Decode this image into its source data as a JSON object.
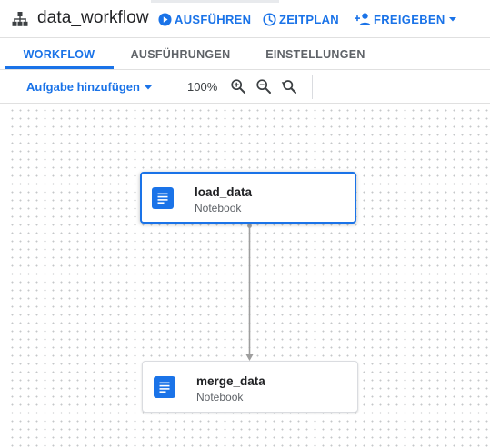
{
  "header": {
    "title": "data_workflow",
    "title_icon": "workflow-tree-icon",
    "actions": [
      {
        "label": "AUSFÜHREN",
        "icon": "play-circle-icon"
      },
      {
        "label": "ZEITPLAN",
        "icon": "clock-icon"
      },
      {
        "label": "FREIGEBEN",
        "icon": "person-add-icon",
        "dropdown_icon": "caret-down-icon"
      }
    ]
  },
  "tabs": [
    {
      "label": "WORKFLOW",
      "active": true
    },
    {
      "label": "AUSFÜHRUNGEN",
      "active": false
    },
    {
      "label": "EINSTELLUNGEN",
      "active": false
    }
  ],
  "toolbar": {
    "add_task_label": "Aufgabe hinzufügen",
    "zoom_level": "100%",
    "zoom_buttons": [
      "zoom-in-icon",
      "zoom-out-icon",
      "zoom-reset-icon"
    ]
  },
  "workflow": {
    "nodes": [
      {
        "name": "load_data",
        "type": "Notebook",
        "icon": "notebook-icon",
        "selected": true
      },
      {
        "name": "merge_data",
        "type": "Notebook",
        "icon": "notebook-icon",
        "selected": false
      }
    ],
    "edges": [
      {
        "from": "load_data",
        "to": "merge_data"
      }
    ]
  },
  "colors": {
    "accent": "#1a73e8",
    "text_primary": "#202124",
    "text_secondary": "#5f6368",
    "divider": "#e0e0e0",
    "edge": "#9e9e9e"
  }
}
